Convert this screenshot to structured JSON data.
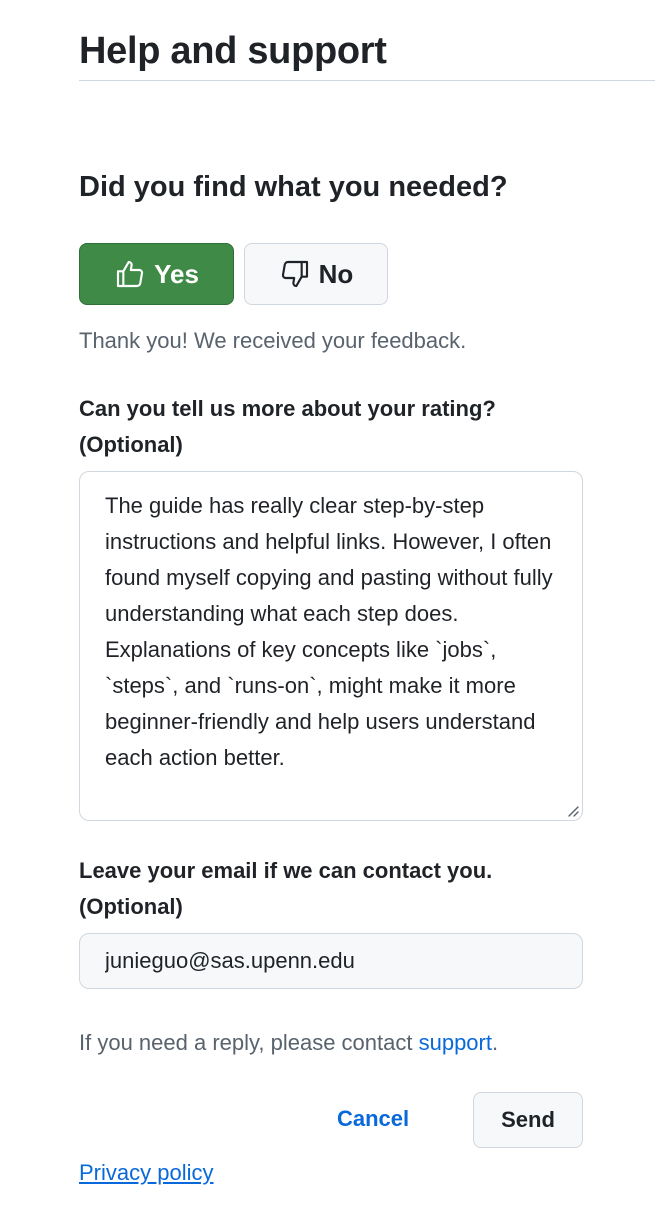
{
  "header": {
    "title": "Help and support"
  },
  "feedback": {
    "question": "Did you find what you needed?",
    "yes_label": "Yes",
    "no_label": "No",
    "selected": "Yes",
    "thanks_message": "Thank you! We received your feedback.",
    "rating_label_line1": "Can you tell us more about your rating?",
    "rating_label_line2": "(Optional)",
    "rating_text": "The guide has really clear step-by-step instructions and helpful links. However, I often found myself copying and pasting without fully understanding what each step does. Explanations of key concepts like `jobs`, `steps`, and `runs-on`, might make it more beginner-friendly and help users understand each action better.",
    "email_label_line1": "Leave your email if we can contact you.",
    "email_label_line2": "(Optional)",
    "email_value": "junieguo@sas.upenn.edu",
    "reply_prefix": "If you need a reply, please contact ",
    "reply_link": "support",
    "reply_suffix": ".",
    "cancel_label": "Cancel",
    "send_label": "Send"
  },
  "footer": {
    "privacy_label": "Privacy policy"
  },
  "icons": {
    "yes": "thumbs-up-icon",
    "no": "thumbs-down-icon"
  },
  "colors": {
    "yes_button": "#3f8a46",
    "link": "#0969da",
    "muted_text": "#59636e"
  }
}
